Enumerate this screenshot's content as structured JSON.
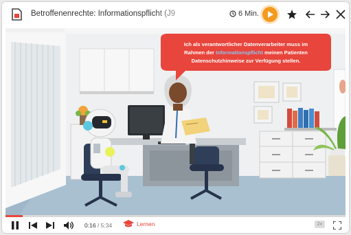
{
  "header": {
    "title": "Betroffenenrechte: Informationspflicht (J9",
    "duration": "6 Min.",
    "icons": [
      "document-icon",
      "clock-icon",
      "play-icon",
      "star-icon",
      "arrow-left-icon",
      "arrow-right-icon",
      "close-icon"
    ]
  },
  "scene": {
    "speech_line1": "Ich als verantwortlicher Datenverarbeiter muss im",
    "speech_line2_pre": "Rahmen der ",
    "speech_line2_highlight": "Informationspflicht",
    "speech_line2_post": " meinen Patienten",
    "speech_line3": "Datenschutzhinweise zur Verfügung stellen.",
    "bubble_color": "#e8453c",
    "highlight_color": "#6fa8dc"
  },
  "player": {
    "progress": 0.05,
    "current_time": "0:16",
    "separator": " / ",
    "total_time": "5:34",
    "learn_label": "Lernen",
    "speed_label": "2x",
    "accent": "#e8453c",
    "icons": [
      "pause-icon",
      "skip-back-icon",
      "skip-forward-icon",
      "volume-icon",
      "graduation-cap-icon",
      "fullscreen-icon"
    ]
  }
}
